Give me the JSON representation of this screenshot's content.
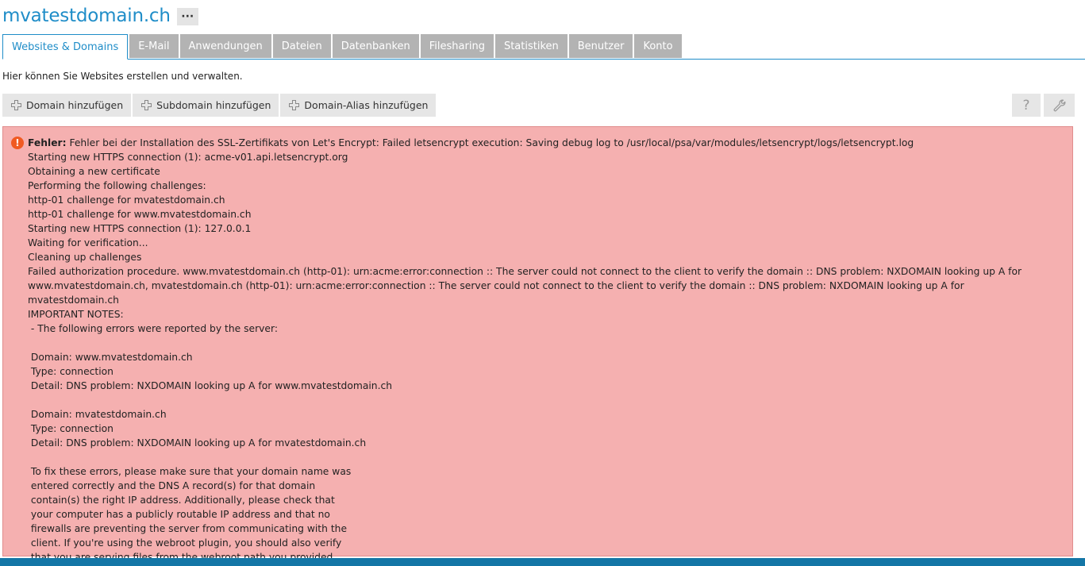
{
  "header": {
    "title": "mvatestdomain.ch",
    "more_label": "···"
  },
  "tabs": [
    {
      "label": "Websites & Domains",
      "active": true
    },
    {
      "label": "E-Mail"
    },
    {
      "label": "Anwendungen"
    },
    {
      "label": "Dateien"
    },
    {
      "label": "Datenbanken"
    },
    {
      "label": "Filesharing"
    },
    {
      "label": "Statistiken"
    },
    {
      "label": "Benutzer"
    },
    {
      "label": "Konto"
    }
  ],
  "description": "Hier können Sie Websites erstellen und verwalten.",
  "toolbar": {
    "add_domain": "Domain hinzufügen",
    "add_subdomain": "Subdomain hinzufügen",
    "add_alias": "Domain-Alias hinzufügen",
    "help_symbol": "?"
  },
  "error": {
    "label": "Fehler:",
    "message": " Fehler bei der Installation des SSL-Zertifikats von Let's Encrypt: Failed letsencrypt execution: Saving debug log to /usr/local/psa/var/modules/letsencrypt/logs/letsencrypt.log\nStarting new HTTPS connection (1): acme-v01.api.letsencrypt.org\nObtaining a new certificate\nPerforming the following challenges:\nhttp-01 challenge for mvatestdomain.ch\nhttp-01 challenge for www.mvatestdomain.ch\nStarting new HTTPS connection (1): 127.0.0.1\nWaiting for verification...\nCleaning up challenges\nFailed authorization procedure. www.mvatestdomain.ch (http-01): urn:acme:error:connection :: The server could not connect to the client to verify the domain :: DNS problem: NXDOMAIN looking up A for\nwww.mvatestdomain.ch, mvatestdomain.ch (http-01): urn:acme:error:connection :: The server could not connect to the client to verify the domain :: DNS problem: NXDOMAIN looking up A for mvatestdomain.ch\nIMPORTANT NOTES:\n - The following errors were reported by the server:\n\n Domain: www.mvatestdomain.ch\n Type: connection\n Detail: DNS problem: NXDOMAIN looking up A for www.mvatestdomain.ch\n\n Domain: mvatestdomain.ch\n Type: connection\n Detail: DNS problem: NXDOMAIN looking up A for mvatestdomain.ch\n\n To fix these errors, please make sure that your domain name was\n entered correctly and the DNS A record(s) for that domain\n contain(s) the right IP address. Additionally, please check that\n your computer has a publicly routable IP address and that no\n firewalls are preventing the server from communicating with the\n client. If you're using the webroot plugin, you should also verify\n that you are serving files from the webroot path you provided."
  }
}
